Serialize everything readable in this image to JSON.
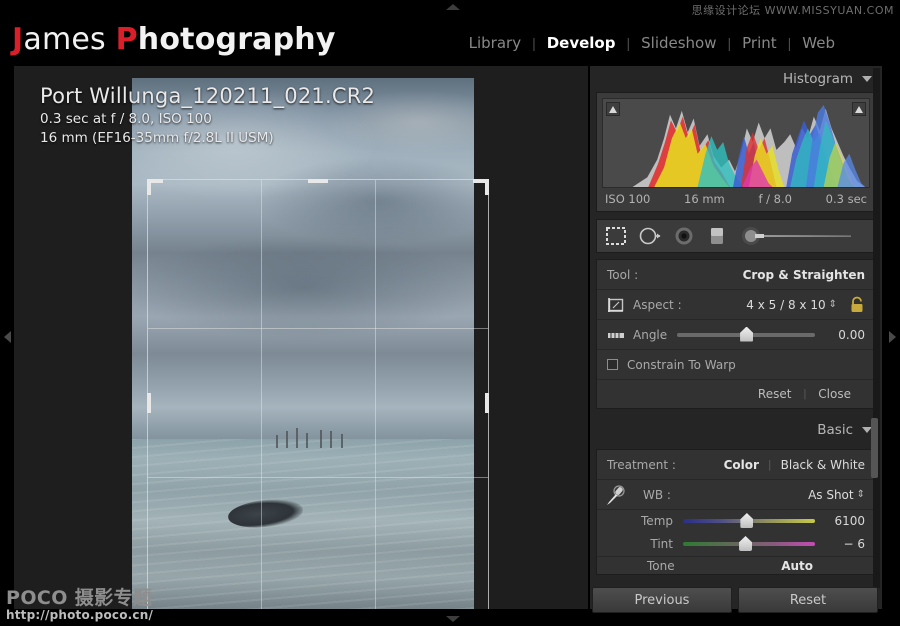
{
  "branding": {
    "logo_first_letter": "J",
    "logo_first_rest": "ames ",
    "logo_second_letter": "P",
    "logo_second_rest": "hotography"
  },
  "modules": {
    "items": [
      {
        "label": "Library",
        "active": false
      },
      {
        "label": "Develop",
        "active": true
      },
      {
        "label": "Slideshow",
        "active": false
      },
      {
        "label": "Print",
        "active": false
      },
      {
        "label": "Web",
        "active": false
      }
    ],
    "separator": "|"
  },
  "watermarks": {
    "top_right": "思缘设计论坛  WWW.MISSYUAN.COM",
    "bottom_left_title": "POCO 摄影专题",
    "bottom_left_url": "http://photo.poco.cn/"
  },
  "image_info": {
    "filename": "Port Willunga_120211_021.CR2",
    "exposure_line": "0.3 sec at f / 8.0, ISO 100",
    "lens_line": "16 mm (EF16-35mm f/2.8L II USM)"
  },
  "histogram": {
    "title": "Histogram",
    "iso": "ISO 100",
    "focal_length": "16 mm",
    "aperture": "f / 8.0",
    "shutter": "0.3 sec",
    "shadow_clip_icon": "triangle-up-icon",
    "highlight_clip_icon": "triangle-up-icon",
    "collapse_icon": "chevron-down-icon"
  },
  "tool_strip": {
    "tools": [
      {
        "name": "crop-overlay-tool",
        "active": true
      },
      {
        "name": "spot-removal-tool",
        "active": false
      },
      {
        "name": "red-eye-correction-tool",
        "active": false
      },
      {
        "name": "graduated-filter-tool",
        "active": false
      },
      {
        "name": "adjustment-brush-tool",
        "active": false
      }
    ]
  },
  "crop_panel": {
    "tool_label": "Tool :",
    "tool_value": "Crop & Straighten",
    "aspect_label": "Aspect :",
    "aspect_value": "4 x 5 / 8 x 10",
    "aspect_stepper": "⇕",
    "lock_icon": "padlock-open-icon",
    "lock_color": "#c8a93c",
    "angle_label": "Angle",
    "angle_value": "0.00",
    "angle_slider_percent": 50,
    "constrain_label": "Constrain To Warp",
    "constrain_checked": false,
    "reset_label": "Reset",
    "close_label": "Close",
    "separator": "|"
  },
  "basic_panel": {
    "title": "Basic",
    "collapse_icon": "chevron-down-icon",
    "treatment_label": "Treatment :",
    "treatment_color": "Color",
    "treatment_bw": "Black & White",
    "treatment_separator": "|",
    "wb_label": "WB :",
    "wb_value": "As Shot",
    "wb_stepper": "⇕",
    "eyedropper_icon": "eyedropper-icon",
    "temp_label": "Temp",
    "temp_value": "6100",
    "temp_slider_percent": 48,
    "tint_label": "Tint",
    "tint_value": "− 6",
    "tint_slider_percent": 47,
    "tone_label": "Tone",
    "auto_label": "Auto"
  },
  "footer_buttons": {
    "previous_label": "Previous",
    "reset_label": "Reset"
  },
  "edge_controls": {
    "left_panel_toggle": "triangle-left-icon",
    "right_panel_toggle": "triangle-right-icon",
    "top_panel_toggle": "triangle-up-icon",
    "bottom_panel_toggle": "triangle-down-icon"
  },
  "colors": {
    "accent_red": "#d9202a",
    "panel_bg": "#252525",
    "module_bg": "#323232",
    "canvas_bg": "#1e1e1e"
  }
}
